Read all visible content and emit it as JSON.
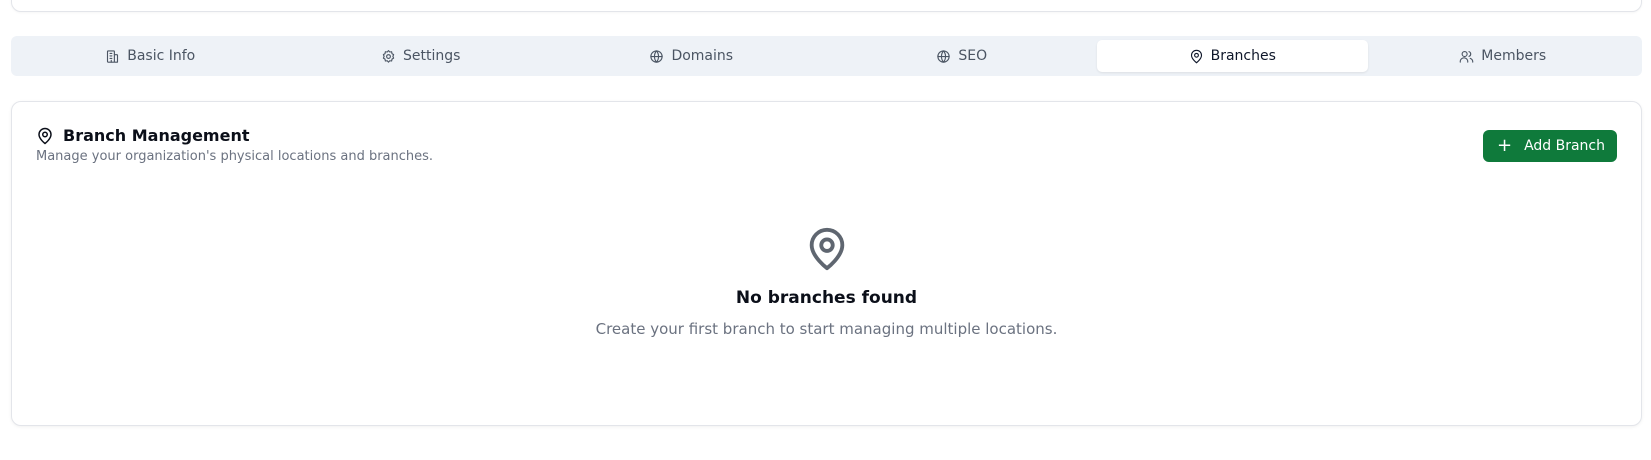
{
  "tabs": [
    {
      "label": "Basic Info",
      "icon": "building-icon",
      "active": false
    },
    {
      "label": "Settings",
      "icon": "gear-icon",
      "active": false
    },
    {
      "label": "Domains",
      "icon": "globe-icon",
      "active": false
    },
    {
      "label": "SEO",
      "icon": "globe-icon",
      "active": false
    },
    {
      "label": "Branches",
      "icon": "map-pin-icon",
      "active": true
    },
    {
      "label": "Members",
      "icon": "users-icon",
      "active": false
    }
  ],
  "branch_management": {
    "title": "Branch Management",
    "description": "Manage your organization's physical locations and branches.",
    "add_button_label": "Add Branch",
    "add_button_icon": "plus-icon"
  },
  "empty_state": {
    "icon": "map-pin-icon",
    "title": "No branches found",
    "description": "Create your first branch to start managing multiple locations."
  },
  "colors": {
    "accent": "#0f7a3b",
    "tab_bar_bg": "#eef2f7",
    "muted_text": "#6b7280"
  }
}
